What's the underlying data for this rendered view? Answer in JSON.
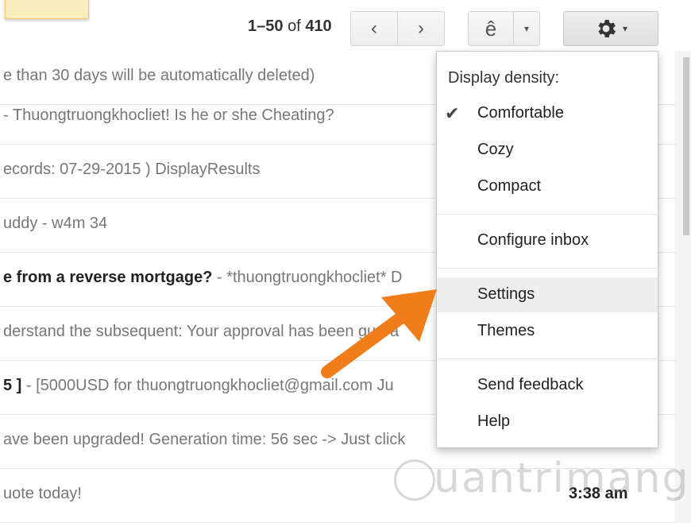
{
  "pager": {
    "range": "1–50",
    "of": "of",
    "total": "410"
  },
  "buttons": {
    "prev": "‹",
    "next": "›",
    "lang": "ê",
    "dropdown_caret": "▾",
    "gear_caret": "▾"
  },
  "emails": [
    {
      "text": "e than 30 days will be automatically deleted)",
      "bold": "",
      "time": ""
    },
    {
      "text": " - Thuongtruongkhocliet! Is he or she Cheating?",
      "bold": "",
      "time": ""
    },
    {
      "text": "ecords: 07-29-2015 ) DisplayResults",
      "bold": "",
      "time": ""
    },
    {
      "text": "uddy - w4m 34",
      "bold": "",
      "time": ""
    },
    {
      "text": " - *thuongtruongkhocliet* D",
      "bold": "e from a reverse mortgage?",
      "time": ""
    },
    {
      "text": "derstand the subsequent: Your approval has been guara",
      "bold": "",
      "time": ""
    },
    {
      "text": " - [5000USD for thuongtruongkhocliet@gmail.com Ju",
      "bold": "5 ]",
      "time": ""
    },
    {
      "text": "ave been upgraded! Generation time: 56 sec -> Just click",
      "bold": "",
      "time": ""
    },
    {
      "text": "uote today!",
      "bold": "",
      "time": "3:38 am"
    }
  ],
  "menu": {
    "heading": "Display density:",
    "check": "✔",
    "items": [
      {
        "label": "Comfortable"
      },
      {
        "label": "Cozy"
      },
      {
        "label": "Compact"
      },
      {
        "label": "Configure inbox"
      },
      {
        "label": "Settings"
      },
      {
        "label": "Themes"
      },
      {
        "label": "Send feedback"
      },
      {
        "label": "Help"
      }
    ]
  },
  "watermark": "uantrimang",
  "colors": {
    "arrow": "#f07c1a",
    "highlight": "#eeeeee"
  },
  "icons": [
    "gear-icon",
    "chevron-left-icon",
    "chevron-right-icon",
    "checkmark-icon",
    "arrow-annotation-icon"
  ]
}
